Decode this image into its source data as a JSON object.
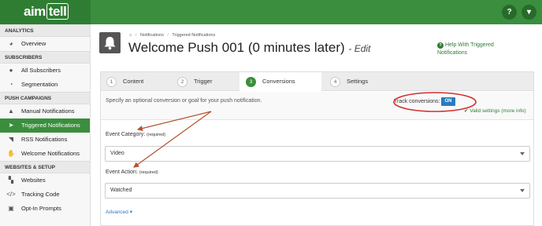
{
  "topbar": {
    "logo_text": "aim",
    "logo_box_text": "tell",
    "help_icon": "?",
    "menu_icon": "▾"
  },
  "sidebar": {
    "analytics_header": "ANALYTICS",
    "overview": "Overview",
    "subscribers_header": "SUBSCRIBERS",
    "all_subscribers": "All Subscribers",
    "segmentation": "Segmentation",
    "push_header": "PUSH CAMPAIGNS",
    "manual": "Manual Notifications",
    "triggered": "Triggered Notifications",
    "rss": "RSS Notifications",
    "welcome": "Welcome Notifications",
    "websites_header": "WEBSITES & SETUP",
    "websites": "Websites",
    "tracking": "Tracking Code",
    "optin": "Opt-In Prompts"
  },
  "breadcrumb": {
    "home_icon": "⌂",
    "notifications": "Notifications",
    "separator": "/",
    "triggered": "Triggered Notifications"
  },
  "page": {
    "title": "Welcome Push 001 (0 minutes later)",
    "title_suffix": "- Edit",
    "help_link": "Help With Triggered Notifications",
    "help_icon": "?"
  },
  "tabs": [
    {
      "num": "1",
      "label": "Content"
    },
    {
      "num": "2",
      "label": "Trigger"
    },
    {
      "num": "3",
      "label": "Conversions"
    },
    {
      "num": "4",
      "label": "Settings"
    }
  ],
  "conversions": {
    "description": "Specify an optional conversion or goal for your push notification.",
    "track_label": "Track conversions:",
    "track_toggle": "ON",
    "valid_check": "✔",
    "valid_text": "Valid settings (more info)",
    "category_label": "Event Category:",
    "category_required": "(required)",
    "category_value": "Video",
    "action_label": "Event Action:",
    "action_required": "(required)",
    "action_value": "Watched",
    "advanced": "Advanced ▾"
  },
  "colors": {
    "brand_green": "#3a8e3d",
    "toggle_blue": "#2a7bc0",
    "annotation_red": "#d32f2f",
    "annotation_brown": "#b5522f"
  }
}
